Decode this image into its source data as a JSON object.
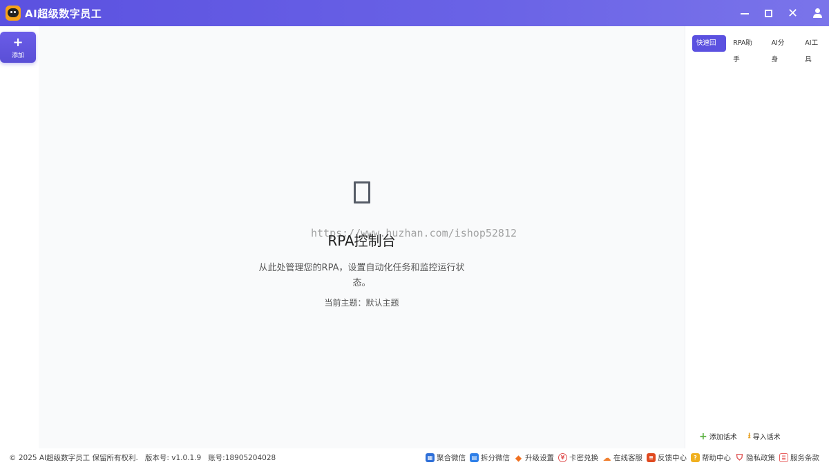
{
  "app": {
    "title": "AI超级数字员工"
  },
  "leftrail": {
    "add_label": "添加",
    "add_symbol": "+"
  },
  "main": {
    "title": "RPA控制台",
    "description": "从此处管理您的RPA，设置自动化任务和监控运行状态。",
    "theme": "当前主题：默认主题",
    "watermark": "https://www.huzhan.com/ishop52812"
  },
  "rightpanel": {
    "tabs": [
      {
        "label": "快速回复",
        "active": true
      },
      {
        "label": "RPA助手",
        "active": false
      },
      {
        "label": "AI分身",
        "active": false
      },
      {
        "label": "AI工具",
        "active": false
      }
    ],
    "actions": [
      {
        "label": "添加话术",
        "icon": "plus-icon"
      },
      {
        "label": "导入话术",
        "icon": "download-icon"
      }
    ]
  },
  "footer": {
    "copyright": "© 2025 AI超级数字员工 保留所有权利.",
    "version": "版本号: v1.0.1.9",
    "account": "账号:18905204028",
    "links": [
      {
        "label": "聚合微信",
        "icon": "grid-icon",
        "color": "#2e6fd8"
      },
      {
        "label": "拆分微信",
        "icon": "split-icon",
        "color": "#2e7fe8"
      },
      {
        "label": "升级设置",
        "icon": "diamond-icon",
        "color": "#f07020"
      },
      {
        "label": "卡密兑换",
        "icon": "coupon-icon",
        "color": "#e05050"
      },
      {
        "label": "在线客服",
        "icon": "service-icon",
        "color": "#f08030"
      },
      {
        "label": "反馈中心",
        "icon": "feedback-icon",
        "color": "#e04a20"
      },
      {
        "label": "帮助中心",
        "icon": "help-icon",
        "color": "#f0b020"
      },
      {
        "label": "隐私政策",
        "icon": "shield-icon",
        "color": "#d83030"
      },
      {
        "label": "服务条款",
        "icon": "document-icon",
        "color": "#e86060"
      }
    ]
  }
}
